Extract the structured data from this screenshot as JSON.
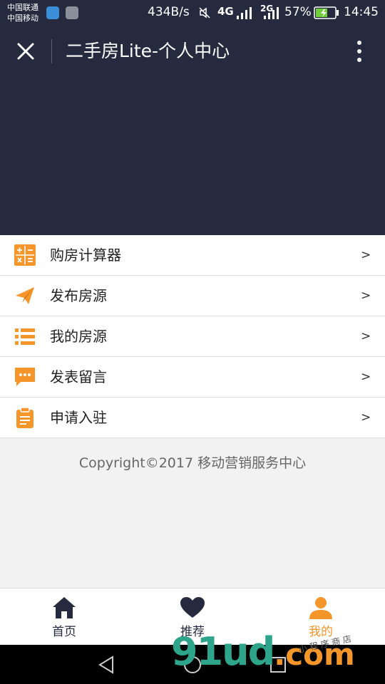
{
  "status_bar": {
    "carrier_1": "中国联通",
    "carrier_2": "中国移动",
    "speed": "434B/s",
    "network_1": "4G",
    "network_2": "2G",
    "battery": "57%",
    "time": "14:45"
  },
  "title_bar": {
    "title": "二手房Lite-个人中心"
  },
  "menu": {
    "items": [
      {
        "label": "购房计算器",
        "icon": "calculator-icon",
        "arrow": ">"
      },
      {
        "label": "发布房源",
        "icon": "paper-plane-icon",
        "arrow": ">"
      },
      {
        "label": "我的房源",
        "icon": "list-icon",
        "arrow": ">"
      },
      {
        "label": "发表留言",
        "icon": "message-icon",
        "arrow": ">"
      },
      {
        "label": "申请入驻",
        "icon": "clipboard-icon",
        "arrow": ">"
      }
    ]
  },
  "footer": {
    "copyright": "Copyright©2017 移动营销服务中心"
  },
  "tab_bar": {
    "tabs": [
      {
        "label": "首页",
        "icon": "home-icon",
        "active": false
      },
      {
        "label": "推荐",
        "icon": "heart-icon",
        "active": false
      },
      {
        "label": "我的",
        "icon": "user-icon",
        "active": true
      }
    ]
  },
  "watermark": {
    "text": "91ud",
    "suffix": ".com",
    "small": "小 程 序 商 店"
  },
  "colors": {
    "header_bg": "#252a3e",
    "accent": "#f5962a",
    "page_bg": "#f2f2f2"
  }
}
